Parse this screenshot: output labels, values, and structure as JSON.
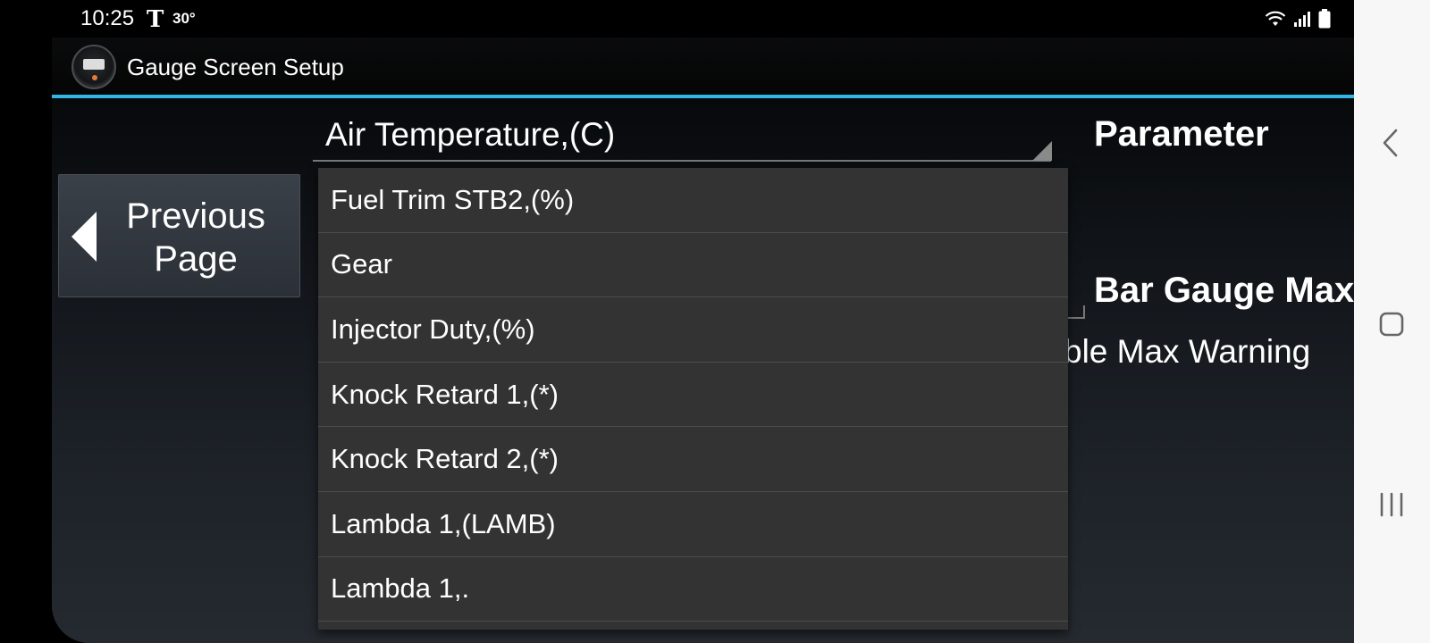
{
  "status_bar": {
    "time": "10:25",
    "carrier_glyph": "T",
    "temperature": "30°"
  },
  "app_bar": {
    "title": "Gauge Screen Setup",
    "accent_color": "#33b5e5"
  },
  "previous_button": {
    "label_line1": "Previous",
    "label_line2": "Page"
  },
  "spinner": {
    "selected_value": "Air Temperature,(C)"
  },
  "labels": {
    "parameter": "Parameter",
    "bar_gauge_max": "Bar Gauge Max",
    "max_warning": "ble Max Warning"
  },
  "dropdown": {
    "items": [
      {
        "label": "Fuel Trim STB2,(%)"
      },
      {
        "label": "Gear"
      },
      {
        "label": "Injector Duty,(%)"
      },
      {
        "label": "Knock Retard 1,(*)"
      },
      {
        "label": "Knock Retard 2,(*)"
      },
      {
        "label": "Lambda 1,(LAMB)"
      },
      {
        "label": "Lambda 1,."
      }
    ]
  },
  "icons": {
    "status": [
      "wifi-icon",
      "signal-icon",
      "battery-icon"
    ],
    "navigation": [
      "back-icon",
      "home-icon",
      "recents-icon"
    ]
  }
}
